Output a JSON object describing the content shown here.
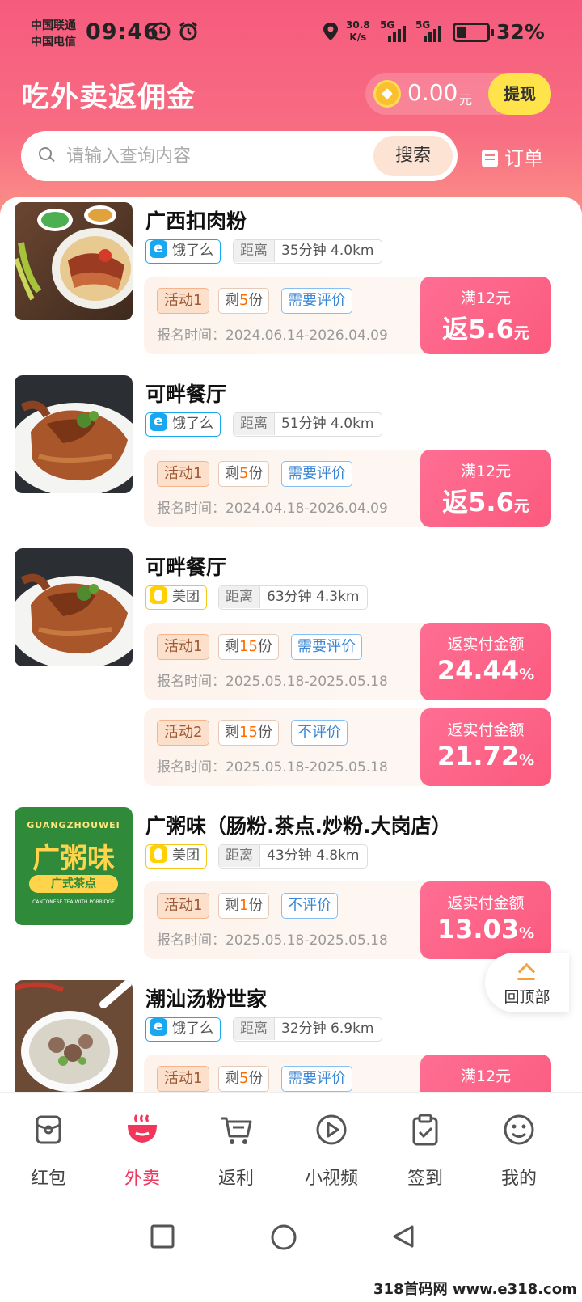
{
  "status_bar": {
    "carrier_1": "中国联通",
    "carrier_2": "中国电信",
    "time": "09:46",
    "net_speed_value": "30.8",
    "net_speed_unit": "K/s",
    "network_1": "5G",
    "network_2": "5G",
    "battery": "32%",
    "battery_level": 0.32
  },
  "header": {
    "title": "吃外卖返佣金",
    "balance": "0.00",
    "balance_unit": "元",
    "withdraw_label": "提现",
    "search_placeholder": "请输入查询内容",
    "search_button": "搜索",
    "orders_label": "订单"
  },
  "colors": {
    "brand_pink": "#f65b7e",
    "reward_pink": "#fb5a7e",
    "eleme_blue": "#19a7f0",
    "meituan_yellow": "#ffd100",
    "active_tab": "#f2355b"
  },
  "shops": [
    {
      "name": "广西扣肉粉",
      "platform": "饿了么",
      "platform_type": "eleme",
      "distance_label": "距离",
      "distance_value": "35分钟 4.0km",
      "image": "braised-pork-rice-noodles-photo",
      "activities": [
        {
          "tag": "活动1",
          "remain_prefix": "剩",
          "remain_num": "5",
          "remain_suffix": "份",
          "review": "需要评价",
          "reg": "报名时间：2024.06.14-2026.04.09",
          "reward_condition": "满12元",
          "reward_amount": "返5.6",
          "reward_unit": "元"
        }
      ]
    },
    {
      "name": "可畔餐厅",
      "platform": "饿了么",
      "platform_type": "eleme",
      "distance_label": "距离",
      "distance_value": "51分钟 4.0km",
      "image": "roast-duck-photo",
      "activities": [
        {
          "tag": "活动1",
          "remain_prefix": "剩",
          "remain_num": "5",
          "remain_suffix": "份",
          "review": "需要评价",
          "reg": "报名时间：2024.04.18-2026.04.09",
          "reward_condition": "满12元",
          "reward_amount": "返5.6",
          "reward_unit": "元"
        }
      ]
    },
    {
      "name": "可畔餐厅",
      "platform": "美团",
      "platform_type": "meituan",
      "distance_label": "距离",
      "distance_value": "63分钟 4.3km",
      "image": "roast-duck-photo",
      "activities": [
        {
          "tag": "活动1",
          "remain_prefix": "剩",
          "remain_num": "15",
          "remain_suffix": "份",
          "review": "需要评价",
          "reg": "报名时间：2025.05.18-2025.05.18",
          "reward_condition": "返实付金额",
          "reward_amount": "24.44",
          "reward_unit": "%"
        },
        {
          "tag": "活动2",
          "remain_prefix": "剩",
          "remain_num": "15",
          "remain_suffix": "份",
          "review": "不评价",
          "reg": "报名时间：2025.05.18-2025.05.18",
          "reward_condition": "返实付金额",
          "reward_amount": "21.72",
          "reward_unit": "%"
        }
      ]
    },
    {
      "name": "广粥味（肠粉.茶点.炒粉.大岗店）",
      "platform": "美团",
      "platform_type": "meituan",
      "distance_label": "距离",
      "distance_value": "43分钟 4.8km",
      "image": "guangzhouwei-logo",
      "logo_text": {
        "pinyin": "GUANGZHOUWEI",
        "main": "广粥味",
        "sub": "广式茶点",
        "en": "CANTONESE TEA WITH PORRIDGE"
      },
      "activities": [
        {
          "tag": "活动1",
          "remain_prefix": "剩",
          "remain_num": "1",
          "remain_suffix": "份",
          "review": "不评价",
          "reg": "报名时间：2025.05.18-2025.05.18",
          "reward_condition": "返实付金额",
          "reward_amount": "13.03",
          "reward_unit": "%"
        }
      ]
    },
    {
      "name": "潮汕汤粉世家",
      "platform": "饿了么",
      "platform_type": "eleme",
      "distance_label": "距离",
      "distance_value": "32分钟 6.9km",
      "image": "beef-soup-noodles-photo",
      "activities": [
        {
          "tag": "活动1",
          "remain_prefix": "剩",
          "remain_num": "5",
          "remain_suffix": "份",
          "review": "需要评价",
          "reg": "",
          "reward_condition": "满12元",
          "reward_amount": "",
          "reward_unit": ""
        }
      ]
    }
  ],
  "back_to_top": "回顶部",
  "bottom_nav": [
    {
      "label": "红包",
      "icon": "red-packet-icon",
      "active": false
    },
    {
      "label": "外卖",
      "icon": "takeout-bowl-icon",
      "active": true
    },
    {
      "label": "返利",
      "icon": "cart-icon",
      "active": false
    },
    {
      "label": "小视频",
      "icon": "play-icon",
      "active": false
    },
    {
      "label": "签到",
      "icon": "clipboard-check-icon",
      "active": false
    },
    {
      "label": "我的",
      "icon": "smiley-face-icon",
      "active": false
    }
  ],
  "watermark": "318首码网 www.e318.com"
}
